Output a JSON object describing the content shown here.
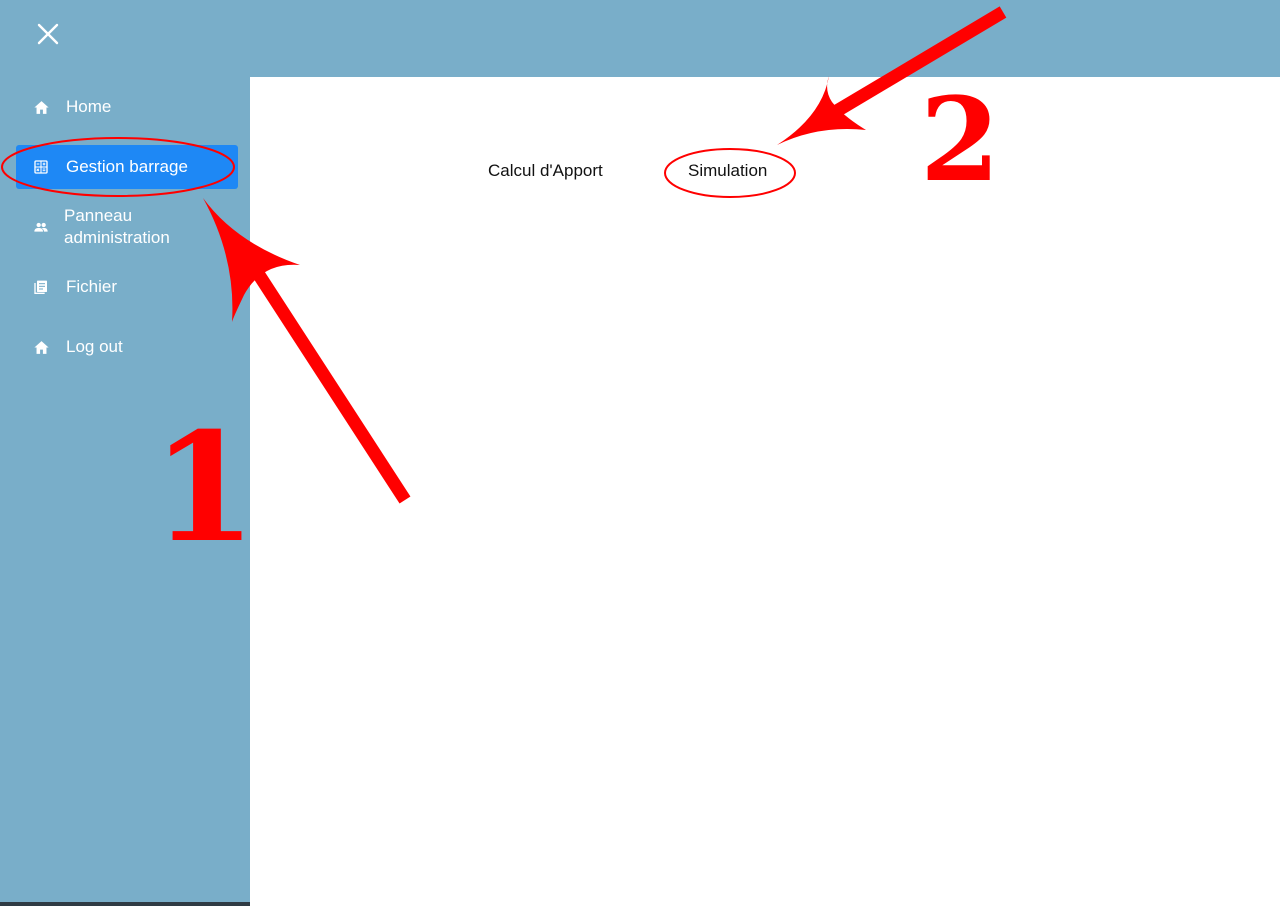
{
  "colors": {
    "chrome_bg": "#79aec9",
    "active_bg": "#1e88f5",
    "annotation": "#ff0000"
  },
  "topbar": {
    "close_icon": "close-icon"
  },
  "sidebar": {
    "items": [
      {
        "label": "Home",
        "icon": "home-icon",
        "active": false
      },
      {
        "label": "Gestion barrage",
        "icon": "calculator-icon",
        "active": true
      },
      {
        "label": "Panneau administration",
        "icon": "people-icon",
        "active": false
      },
      {
        "label": "Fichier",
        "icon": "document-icon",
        "active": false
      },
      {
        "label": "Log out",
        "icon": "home-icon",
        "active": false
      }
    ]
  },
  "main": {
    "tabs": [
      {
        "label": "Calcul d'Apport"
      },
      {
        "label": "Simulation"
      }
    ]
  },
  "annotations": {
    "step_1": "1",
    "step_2": "2"
  }
}
